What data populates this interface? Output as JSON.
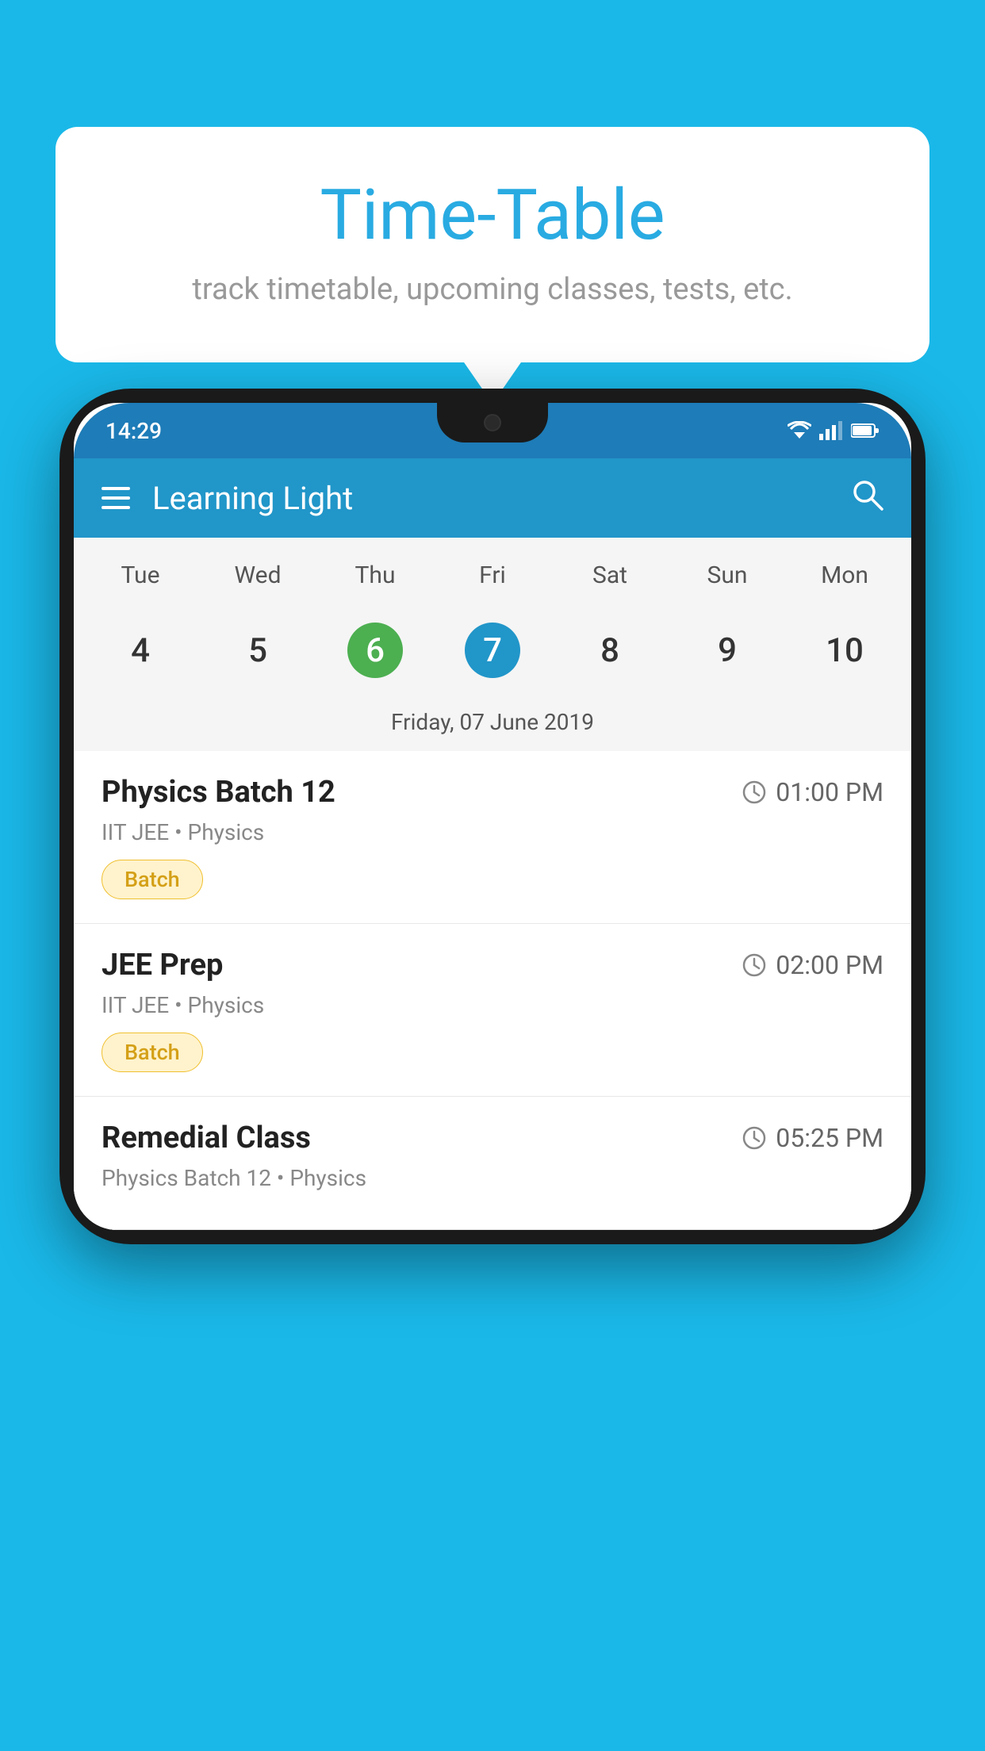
{
  "background_color": "#1ab8e8",
  "bubble": {
    "title": "Time-Table",
    "subtitle": "track timetable, upcoming classes, tests, etc."
  },
  "phone": {
    "status_bar": {
      "time": "14:29"
    },
    "app_header": {
      "title": "Learning Light"
    },
    "calendar": {
      "day_names": [
        "Tue",
        "Wed",
        "Thu",
        "Fri",
        "Sat",
        "Sun",
        "Mon"
      ],
      "dates": [
        {
          "number": "4",
          "state": "normal"
        },
        {
          "number": "5",
          "state": "normal"
        },
        {
          "number": "6",
          "state": "today"
        },
        {
          "number": "7",
          "state": "selected"
        },
        {
          "number": "8",
          "state": "normal"
        },
        {
          "number": "9",
          "state": "normal"
        },
        {
          "number": "10",
          "state": "normal"
        }
      ],
      "selected_date_label": "Friday, 07 June 2019"
    },
    "schedule": [
      {
        "name": "Physics Batch 12",
        "time": "01:00 PM",
        "meta": "IIT JEE • Physics",
        "badge": "Batch"
      },
      {
        "name": "JEE Prep",
        "time": "02:00 PM",
        "meta": "IIT JEE • Physics",
        "badge": "Batch"
      },
      {
        "name": "Remedial Class",
        "time": "05:25 PM",
        "meta": "Physics Batch 12 • Physics",
        "badge": ""
      }
    ]
  }
}
